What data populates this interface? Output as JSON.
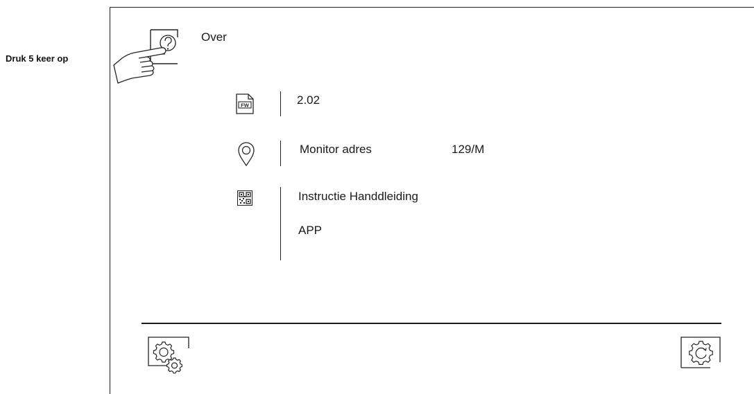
{
  "instruction": {
    "label": "Druk 5 keer op"
  },
  "header": {
    "title": "Over",
    "help_icon": "help-question-icon",
    "hand_icon": "pointing-hand-icon"
  },
  "info": {
    "firmware": {
      "icon": "firmware-fw-icon",
      "value": "2.02"
    },
    "address": {
      "icon": "location-pin-icon",
      "label": "Monitor adres",
      "value": "129/M"
    },
    "manual": {
      "icon": "qr-code-icon",
      "label": "Instructie Handdleiding",
      "app_label": "APP"
    }
  },
  "footer": {
    "left_icon": "advanced-settings-icon",
    "right_icon": "reset-settings-icon"
  }
}
